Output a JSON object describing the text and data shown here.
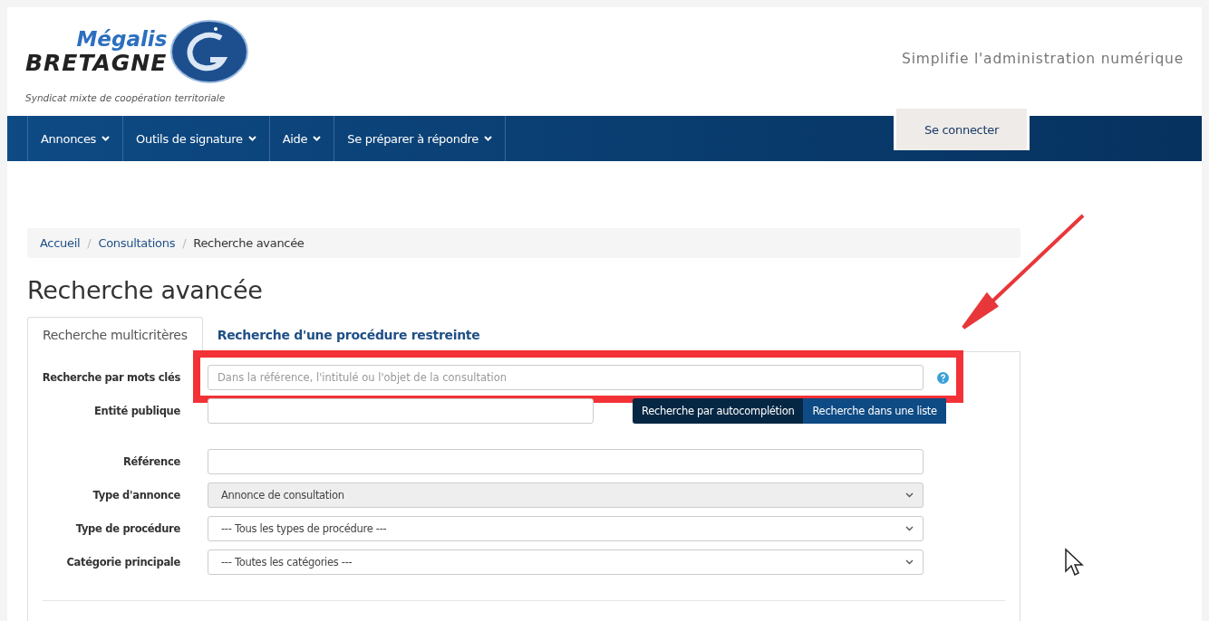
{
  "header": {
    "logo_top": "Mégalis",
    "logo_bottom": "BRETAGNE",
    "logo_subtitle": "Syndicat mixte de coopération territoriale",
    "tagline": "Simplifie l'administration numérique"
  },
  "nav": {
    "items": [
      {
        "label": "Annonces"
      },
      {
        "label": "Outils de signature"
      },
      {
        "label": "Aide"
      },
      {
        "label": "Se préparer à répondre"
      }
    ],
    "login": "Se connecter"
  },
  "breadcrumb": [
    {
      "label": "Accueil",
      "link": true
    },
    {
      "separator": "/",
      "label": "Consultations",
      "link": true
    },
    {
      "separator": "/",
      "label": "Recherche avancée",
      "link": false
    }
  ],
  "title": "Recherche avancée",
  "tabs": [
    {
      "label": "Recherche multicritères",
      "selected": true
    },
    {
      "label": "Recherche d'une procédure restreinte",
      "selected": false
    }
  ],
  "form": [
    {
      "kind": "text",
      "label": "Recherche par mots clés",
      "placeholder": "Dans la référence, l'intitulé ou l'objet de la consultation",
      "help": true,
      "highlighted": true
    },
    {
      "kind": "entity",
      "label": "Entité publique",
      "buttons": [
        {
          "label": "Recherche par autocomplétion",
          "selected": true
        },
        {
          "label": "Recherche dans une liste",
          "selected": false
        }
      ]
    },
    {
      "kind": "text",
      "label": "Référence"
    },
    {
      "kind": "select",
      "label": "Type d'annonce",
      "value": "Annonce de consultation",
      "disabled": true
    },
    {
      "kind": "select",
      "label": "Type de procédure",
      "value": "--- Tous les types de procédure ---",
      "disabled": false
    },
    {
      "kind": "select",
      "label": "Catégorie principale",
      "value": "--- Toutes les catégories ---",
      "disabled": false
    }
  ]
}
